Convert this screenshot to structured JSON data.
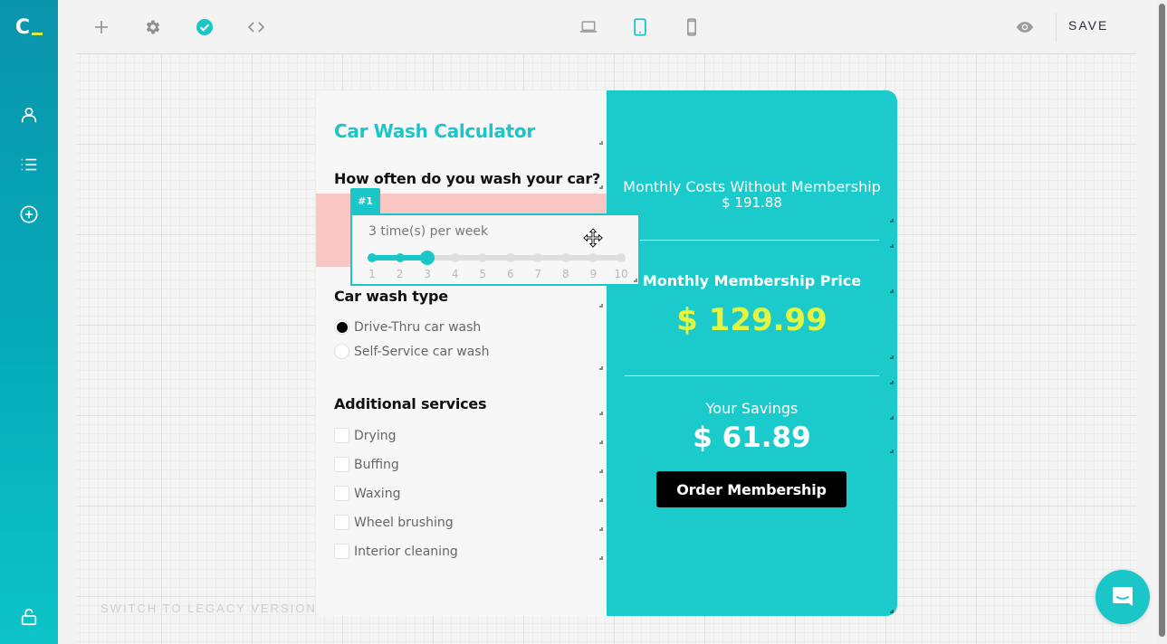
{
  "app": {
    "logo_text": "C",
    "accent_color": "#1bc6c8",
    "highlight_color": "#e4f53f"
  },
  "toolbar": {
    "left_buttons": [
      {
        "name": "add",
        "icon": "plus-icon"
      },
      {
        "name": "settings",
        "icon": "gear-icon"
      },
      {
        "name": "validate",
        "icon": "check-circle-icon",
        "active": true
      },
      {
        "name": "code",
        "icon": "code-icon"
      }
    ],
    "devices": [
      {
        "name": "desktop",
        "icon": "laptop-icon",
        "active": false
      },
      {
        "name": "tablet",
        "icon": "tablet-icon",
        "active": true
      },
      {
        "name": "mobile",
        "icon": "phone-icon",
        "active": false
      }
    ],
    "preview_icon": "eye-icon",
    "save_label": "SAVE"
  },
  "sidebar": {
    "items": [
      {
        "name": "account",
        "icon": "user-icon"
      },
      {
        "name": "list",
        "icon": "list-icon"
      },
      {
        "name": "add",
        "icon": "plus-circle-icon"
      }
    ],
    "bottom_icon": "unlock-icon"
  },
  "canvas": {
    "legacy_link": "SWITCH TO LEGACY VERSION"
  },
  "calculator": {
    "title": "Car Wash Calculator",
    "frequency": {
      "label": "How often do you wash your car?",
      "tag": "#1",
      "value_text": "3 time(s) per week",
      "min": 1,
      "max": 10,
      "value": 3,
      "ticks": [
        "1",
        "2",
        "3",
        "4",
        "5",
        "6",
        "7",
        "8",
        "9",
        "10"
      ]
    },
    "wash_type": {
      "label": "Car wash type",
      "options": [
        {
          "label": "Drive-Thru car wash",
          "selected": true
        },
        {
          "label": "Self-Service car wash",
          "selected": false
        }
      ]
    },
    "additional": {
      "label": "Additional services",
      "options": [
        {
          "label": "Drying",
          "checked": false
        },
        {
          "label": "Buffing",
          "checked": false
        },
        {
          "label": "Waxing",
          "checked": false
        },
        {
          "label": "Wheel brushing",
          "checked": false
        },
        {
          "label": "Interior cleaning",
          "checked": false
        }
      ]
    },
    "results": {
      "without_label": "Monthly Costs Without Membership",
      "without_value": "$ 191.88",
      "membership_label": "Monthly Membership Price",
      "membership_value": "$ 129.99",
      "savings_label": "Your Savings",
      "savings_value": "$ 61.89",
      "order_button": "Order Membership"
    }
  },
  "chat": {
    "icon": "chat-bubble-icon"
  }
}
